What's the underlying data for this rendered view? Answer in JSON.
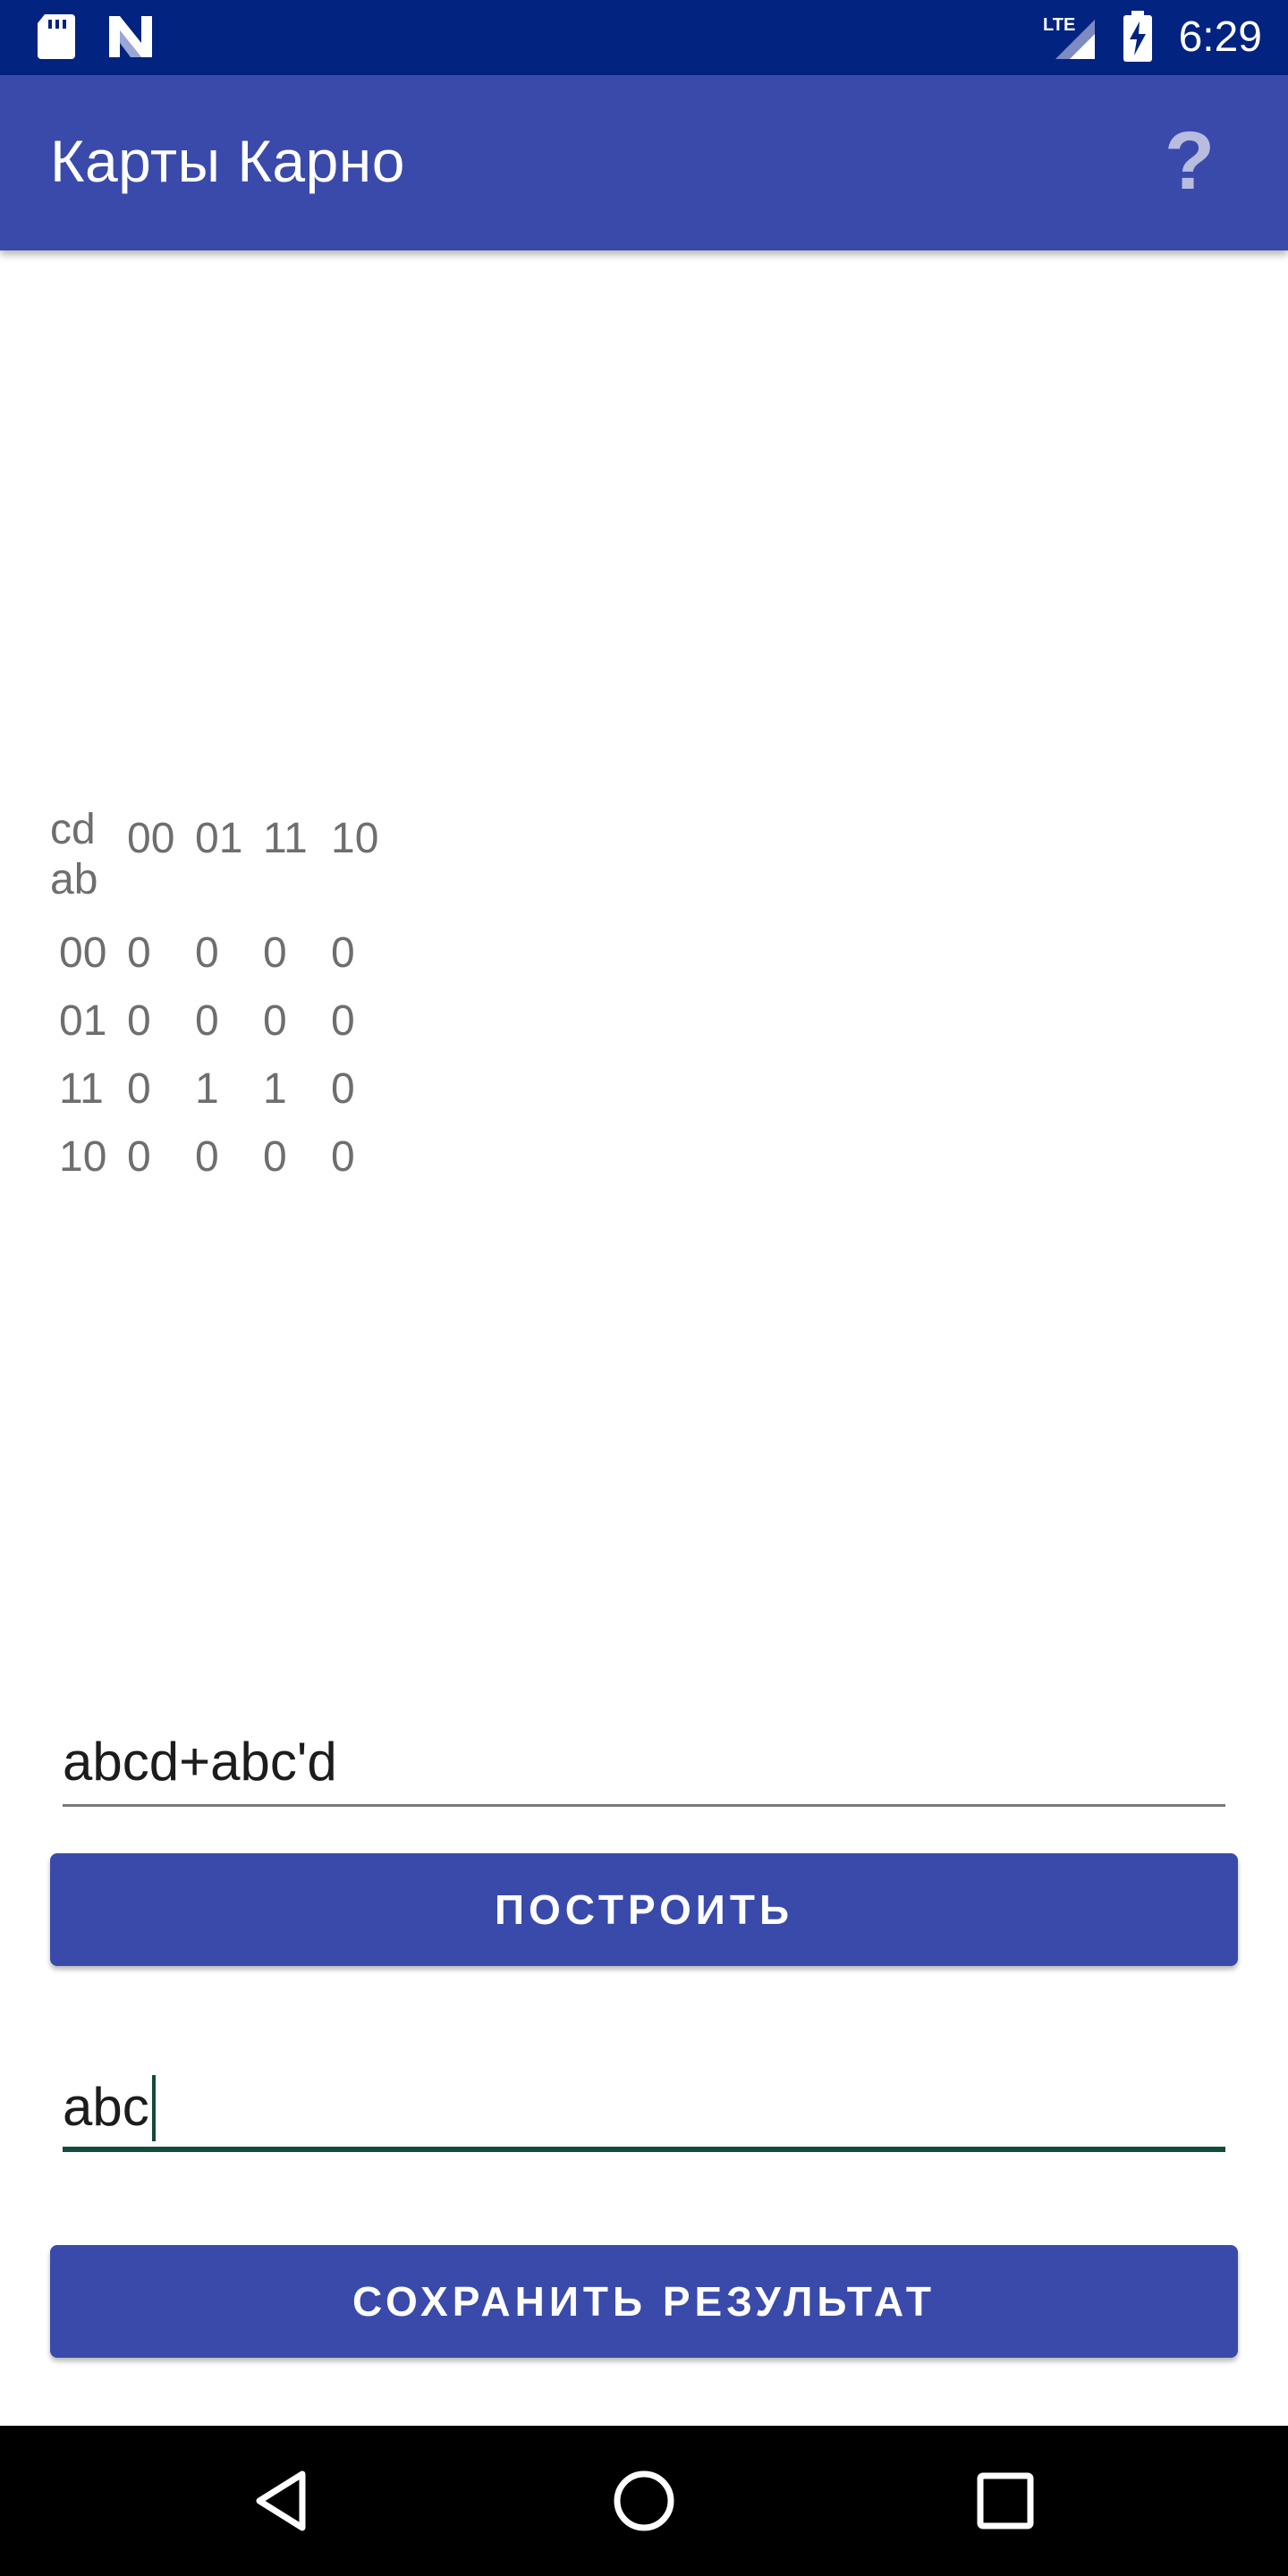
{
  "status_bar": {
    "time": "6:29",
    "network": "LTE",
    "icons": [
      "sd-card-icon",
      "notification-n-icon",
      "signal-icon",
      "battery-charging-icon"
    ],
    "background": "#02237f"
  },
  "app_bar": {
    "title": "Карты Карно",
    "help_label": "?",
    "background": "#3a4aab"
  },
  "kmap": {
    "corner_col_var": "cd",
    "corner_row_var": "ab",
    "col_headers": [
      "00",
      "01",
      "11",
      "10"
    ],
    "rows": [
      {
        "header": "00",
        "cells": [
          "0",
          "0",
          "0",
          "0"
        ]
      },
      {
        "header": "01",
        "cells": [
          "0",
          "0",
          "0",
          "0"
        ]
      },
      {
        "header": "11",
        "cells": [
          "0",
          "1",
          "1",
          "0"
        ]
      },
      {
        "header": "10",
        "cells": [
          "0",
          "0",
          "0",
          "0"
        ]
      }
    ]
  },
  "expression_input": {
    "value": "abcd+abc'd"
  },
  "build_button": {
    "label": "ПОСТРОИТЬ"
  },
  "result_input": {
    "value": "abc"
  },
  "save_button": {
    "label": "СОХРАНИТЬ РЕЗУЛЬТАТ"
  },
  "nav_bar": {
    "buttons": [
      "back-icon",
      "home-icon",
      "recents-icon"
    ]
  },
  "colors": {
    "primary": "#3a4aab",
    "primary_dark": "#02237f",
    "accent_underline": "#124a3b",
    "kmap_text": "#6e6e6e"
  }
}
